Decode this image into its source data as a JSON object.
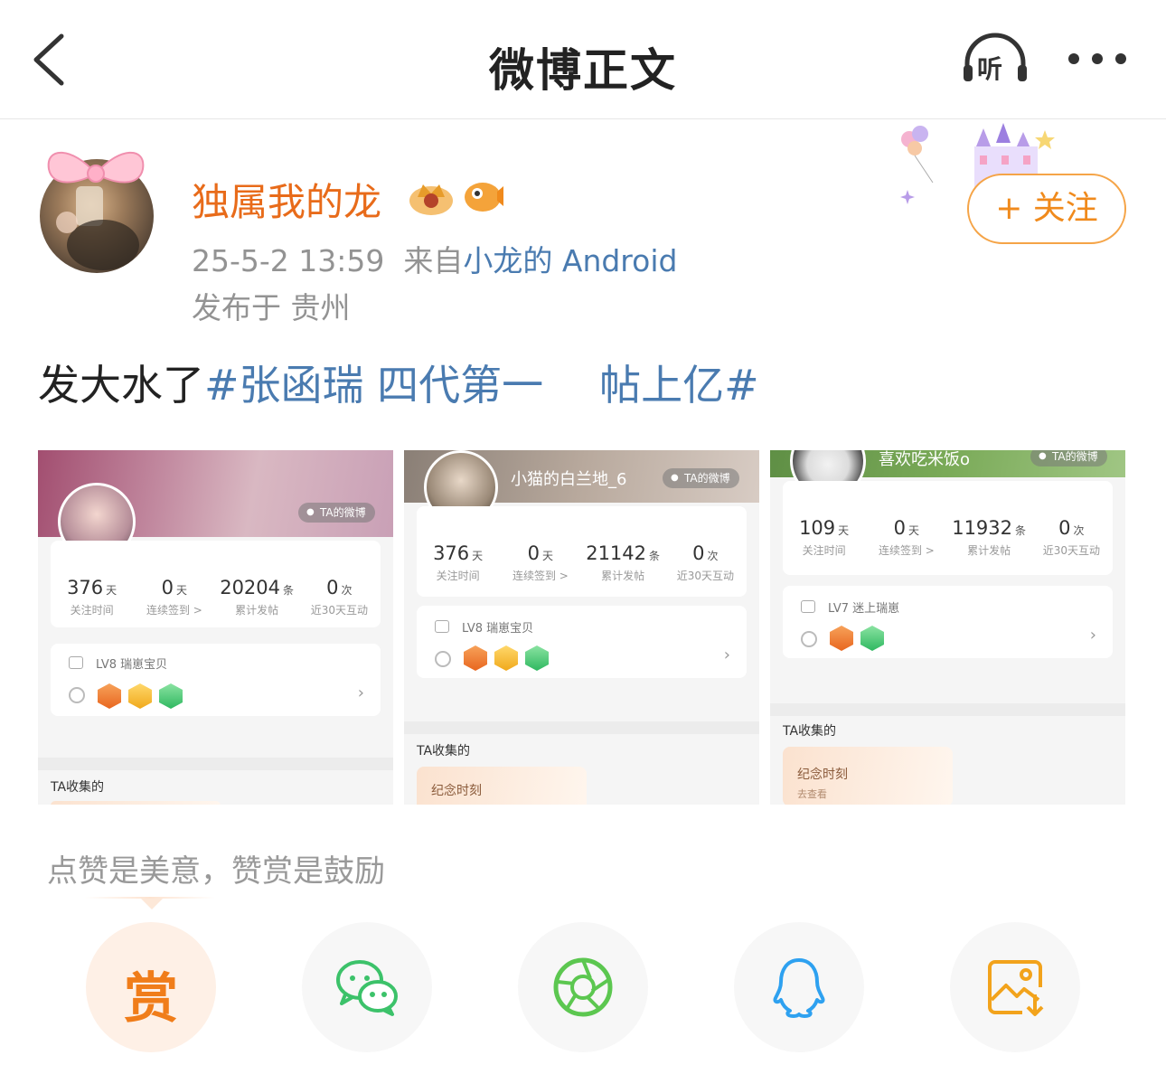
{
  "navbar": {
    "title": "微博正文",
    "back_icon": "chevron-left-icon",
    "listen_label": "听",
    "more_icon": "more-dots-icon"
  },
  "post": {
    "username": "独属我的龙",
    "timestamp": "25-5-2 13:59",
    "source_prefix": "来自",
    "source": "小龙的 Android",
    "location": "发布于 贵州",
    "follow_label": "+ 关注",
    "text_plain": "发大水了",
    "topic": "#张函瑞 四代第一",
    "topic_tail": "帖上亿#"
  },
  "images": [
    {
      "stats": [
        {
          "num": "376",
          "unit": "天",
          "label": "关注时间"
        },
        {
          "num": "0",
          "unit": "天",
          "label": "连续签到 >"
        },
        {
          "num": "20204",
          "unit": "条",
          "label": "累计发帖"
        },
        {
          "num": "0",
          "unit": "次",
          "label": "近30天互动"
        }
      ],
      "ta_label": "TA的微博",
      "level": "LV8 瑞崽宝贝",
      "collect_title": "TA收集的"
    },
    {
      "name": "小猫的白兰地_6",
      "ta_label": "TA的微博",
      "stats": [
        {
          "num": "376",
          "unit": "天",
          "label": "关注时间"
        },
        {
          "num": "0",
          "unit": "天",
          "label": "连续签到 >"
        },
        {
          "num": "21142",
          "unit": "条",
          "label": "累计发帖"
        },
        {
          "num": "0",
          "unit": "次",
          "label": "近30天互动"
        }
      ],
      "level": "LV8 瑞崽宝贝",
      "collect_title": "TA收集的",
      "collect_label": "纪念时刻"
    },
    {
      "name": "喜欢吃米饭o",
      "ta_label": "TA的微博",
      "stats": [
        {
          "num": "109",
          "unit": "天",
          "label": "关注时间"
        },
        {
          "num": "0",
          "unit": "天",
          "label": "连续签到 >"
        },
        {
          "num": "11932",
          "unit": "条",
          "label": "累计发帖"
        },
        {
          "num": "0",
          "unit": "次",
          "label": "近30天互动"
        }
      ],
      "level": "LV7 迷上瑞崽",
      "collect_title": "TA收集的",
      "collect_label": "纪念时刻",
      "collect_sub": "去查看"
    }
  ],
  "reward": {
    "hint": "点赞是美意，赞赏是鼓励",
    "reward_char": "赏"
  },
  "share": {
    "items": [
      "reward-icon",
      "wechat-icon",
      "moments-icon",
      "qq-icon",
      "save-image-icon"
    ]
  },
  "colors": {
    "username": "#e86b1a",
    "topic_link": "#4a7bb0",
    "follow_border": "#f5a447",
    "reward_orange": "#f07d1a",
    "wechat_green": "#3cc26a",
    "moments_green": "#5cc750",
    "qq_blue": "#2ea1f0",
    "save_orange": "#f2a31c"
  }
}
